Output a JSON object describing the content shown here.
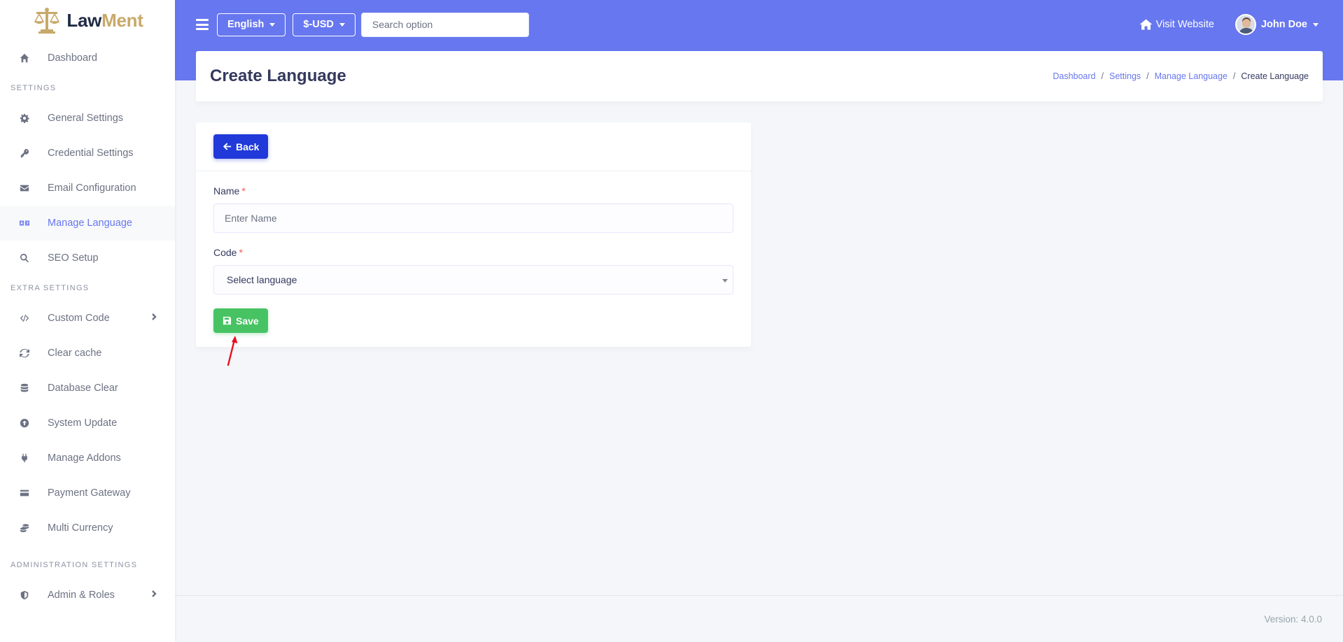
{
  "brand": {
    "name_part1": "Law",
    "name_part2": "Ment"
  },
  "sidebar": {
    "dashboard": "Dashboard",
    "section_settings": "SETTINGS",
    "general_settings": "General Settings",
    "credential_settings": "Credential Settings",
    "email_configuration": "Email Configuration",
    "manage_language": "Manage Language",
    "seo_setup": "SEO Setup",
    "section_extra": "EXTRA SETTINGS",
    "custom_code": "Custom Code",
    "clear_cache": "Clear cache",
    "database_clear": "Database Clear",
    "system_update": "System Update",
    "manage_addons": "Manage Addons",
    "payment_gateway": "Payment Gateway",
    "multi_currency": "Multi Currency",
    "section_admin": "ADMINISTRATION SETTINGS",
    "admin_roles": "Admin & Roles"
  },
  "navbar": {
    "language": "English",
    "currency": "$-USD",
    "search_placeholder": "Search option",
    "visit_website": "Visit Website",
    "user_name": "John Doe"
  },
  "header": {
    "title": "Create Language",
    "breadcrumb": {
      "dashboard": "Dashboard",
      "settings": "Settings",
      "manage_language": "Manage Language",
      "current": "Create Language",
      "separator": "/"
    }
  },
  "form": {
    "back_label": "Back",
    "name_label": "Name",
    "name_placeholder": "Enter Name",
    "code_label": "Code",
    "code_selected": "Select language",
    "required_mark": "*",
    "save_label": "Save"
  },
  "footer": {
    "version": "Version: 4.0.0"
  },
  "colors": {
    "primary": "#6777ef",
    "back_button": "#2039d8",
    "save_button": "#47c363",
    "required": "#fc544b",
    "annotation_arrow": "#e8101f"
  }
}
